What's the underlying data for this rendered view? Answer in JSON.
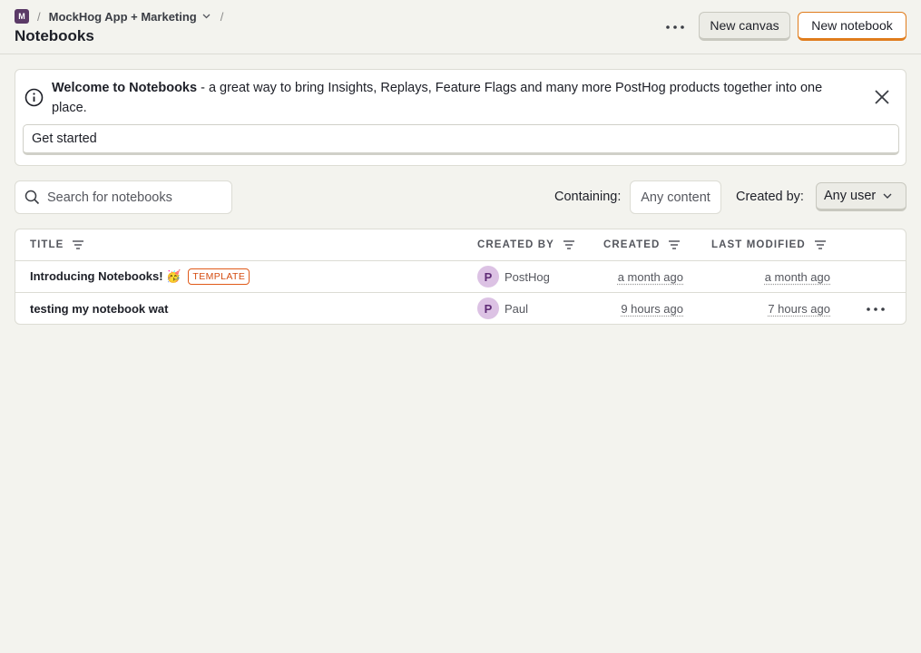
{
  "breadcrumb": {
    "project_initial": "M",
    "separator": "/",
    "project_name": "MockHog App + Marketing"
  },
  "page": {
    "title": "Notebooks"
  },
  "header": {
    "new_canvas_label": "New canvas",
    "new_notebook_label": "New notebook"
  },
  "banner": {
    "title": "Welcome to Notebooks",
    "text": " - a great way to bring Insights, Replays, Feature Flags and many more PostHog products together into one place.",
    "cta_label": "Get started"
  },
  "filters": {
    "search_placeholder": "Search for notebooks",
    "containing_label": "Containing:",
    "containing_value": "Any content",
    "created_by_label": "Created by:",
    "created_by_value": "Any user"
  },
  "table": {
    "columns": [
      "TITLE",
      "CREATED BY",
      "CREATED",
      "LAST MODIFIED"
    ],
    "rows": [
      {
        "title": "Introducing Notebooks! 🥳",
        "tag": "TEMPLATE",
        "avatar": "P",
        "created_by": "PostHog",
        "created": "a month ago",
        "last_modified": "a month ago"
      },
      {
        "title": "testing my notebook wat",
        "avatar": "P",
        "created_by": "Paul",
        "created": "9 hours ago",
        "last_modified": "7 hours ago"
      }
    ]
  },
  "colors": {
    "background": "#f3f3ee",
    "accent_orange": "#e07c1c",
    "template_tag": "#d44c10",
    "avatar_bg": "#dcc2e4",
    "project_badge": "#5b3a67"
  }
}
